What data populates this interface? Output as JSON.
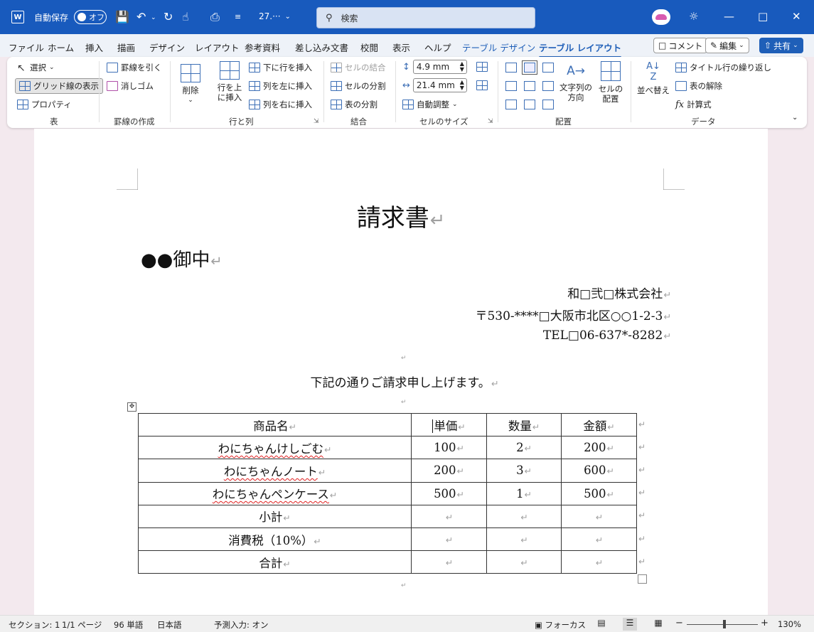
{
  "titlebar": {
    "autosave_label": "自動保存",
    "autosave_state": "オフ",
    "doc_name": "27.···",
    "search_placeholder": "検索"
  },
  "tabs": [
    {
      "label": "ファイル"
    },
    {
      "label": "ホーム"
    },
    {
      "label": "挿入"
    },
    {
      "label": "描画"
    },
    {
      "label": "デザイン"
    },
    {
      "label": "レイアウト"
    },
    {
      "label": "参考資料"
    },
    {
      "label": "差し込み文書"
    },
    {
      "label": "校閲"
    },
    {
      "label": "表示"
    },
    {
      "label": "ヘルプ"
    },
    {
      "label": "テーブル デザイン"
    },
    {
      "label": "テーブル レイアウト"
    }
  ],
  "right_buttons": {
    "comment": "コメント",
    "edit": "編集",
    "share": "共有"
  },
  "ribbon": {
    "table_group": {
      "select": "選択",
      "gridlines": "グリッド線の表示",
      "properties": "プロパティ",
      "label": "表"
    },
    "borders_group": {
      "draw": "罫線を引く",
      "eraser": "消しゴム",
      "label": "罫線の作成"
    },
    "rows_group": {
      "delete": "削除",
      "insert_above_1": "行を上",
      "insert_above_2": "に挿入",
      "insert_below": "下に行を挿入",
      "insert_left": "列を左に挿入",
      "insert_right": "列を右に挿入",
      "label": "行と列"
    },
    "merge_group": {
      "merge": "セルの結合",
      "split_cells": "セルの分割",
      "split_table": "表の分割",
      "label": "結合"
    },
    "size_group": {
      "height": "4.9 mm",
      "width": "21.4 mm",
      "autofit": "自動調整",
      "label": "セルのサイズ"
    },
    "align_group": {
      "direction_1": "文字列の",
      "direction_2": "方向",
      "margins_1": "セルの",
      "margins_2": "配置",
      "label": "配置"
    },
    "data_group": {
      "sort": "並べ替え",
      "repeat_header": "タイトル行の繰り返し",
      "convert": "表の解除",
      "formula": "計算式",
      "label": "データ"
    }
  },
  "document": {
    "title": "請求書",
    "addressee": "●●御中",
    "company": "和□弐□株式会社",
    "address": "〒530-****□大阪市北区○○1-2-3",
    "tel": "TEL□06-637*-8282",
    "intro": "下記の通りご請求申し上げます。",
    "table": {
      "header": [
        "商品名",
        "単価",
        "数量",
        "金額"
      ],
      "rows": [
        [
          "わにちゃんけしごむ",
          "100",
          "2",
          "200"
        ],
        [
          "わにちゃんノート",
          "200",
          "3",
          "600"
        ],
        [
          "わにちゃんペンケース",
          "500",
          "1",
          "500"
        ],
        [
          "小計",
          "",
          "",
          ""
        ],
        [
          "消費税（10%）",
          "",
          "",
          ""
        ],
        [
          "合計",
          "",
          "",
          ""
        ]
      ]
    }
  },
  "statusbar": {
    "section": "セクション: 1",
    "page": "1/1 ページ",
    "words": "96 単語",
    "language": "日本語",
    "predict": "予測入力: オン",
    "focus": "フォーカス",
    "zoom": "130%"
  }
}
